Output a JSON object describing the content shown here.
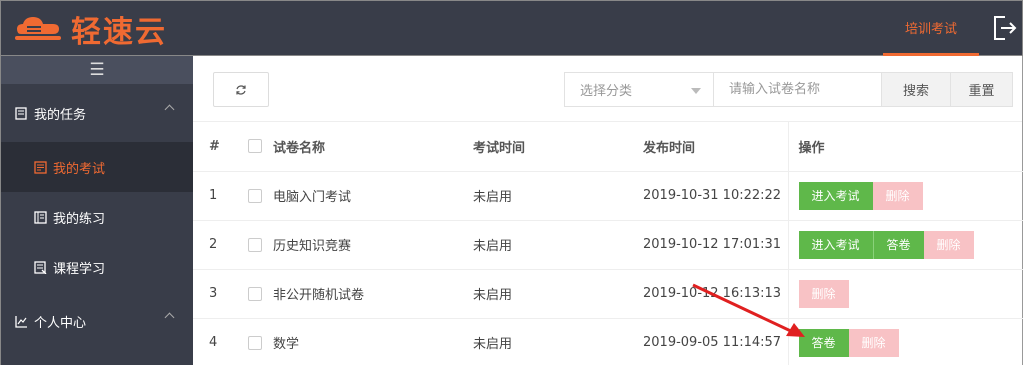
{
  "header": {
    "logo_text": "轻速云",
    "nav_item": "培训考试",
    "logout_icon": "logout-icon"
  },
  "sidebar": {
    "toggle_icon": "menu-icon",
    "groups": [
      {
        "label": "我的任务",
        "icon": "task-icon",
        "items": [
          {
            "label": "我的考试",
            "icon": "exam-icon",
            "active": true
          },
          {
            "label": "我的练习",
            "icon": "practice-icon"
          },
          {
            "label": "课程学习",
            "icon": "course-icon"
          }
        ]
      },
      {
        "label": "个人中心",
        "icon": "chart-icon"
      }
    ]
  },
  "toolbar": {
    "refresh_icon": "refresh-icon",
    "category_placeholder": "选择分类",
    "search_placeholder": "请输入试卷名称",
    "search_label": "搜索",
    "reset_label": "重置"
  },
  "table": {
    "headers": [
      "#",
      "试卷名称",
      "考试时间",
      "发布时间",
      "操作"
    ],
    "rows": [
      {
        "num": "1",
        "name": "电脑入门考试",
        "exam_time": "未启用",
        "publish_time": "2019-10-31 10:22:22",
        "actions": [
          "进入考试",
          "删除"
        ]
      },
      {
        "num": "2",
        "name": "历史知识竞赛",
        "exam_time": "未启用",
        "publish_time": "2019-10-12 17:01:31",
        "actions": [
          "进入考试",
          "答卷",
          "删除"
        ]
      },
      {
        "num": "3",
        "name": "非公开随机试卷",
        "exam_time": "未启用",
        "publish_time": "2019-10-12 16:13:13",
        "actions": [
          "删除"
        ]
      },
      {
        "num": "4",
        "name": "数学",
        "exam_time": "未启用",
        "publish_time": "2019-09-05 11:14:57",
        "actions": [
          "答卷",
          "删除"
        ]
      }
    ]
  },
  "colors": {
    "accent": "#f06a32",
    "header_bg": "#393d49",
    "btn_green": "#5fb84a",
    "btn_pink": "#f8c2c5",
    "annotation_arrow": "#e02020"
  }
}
